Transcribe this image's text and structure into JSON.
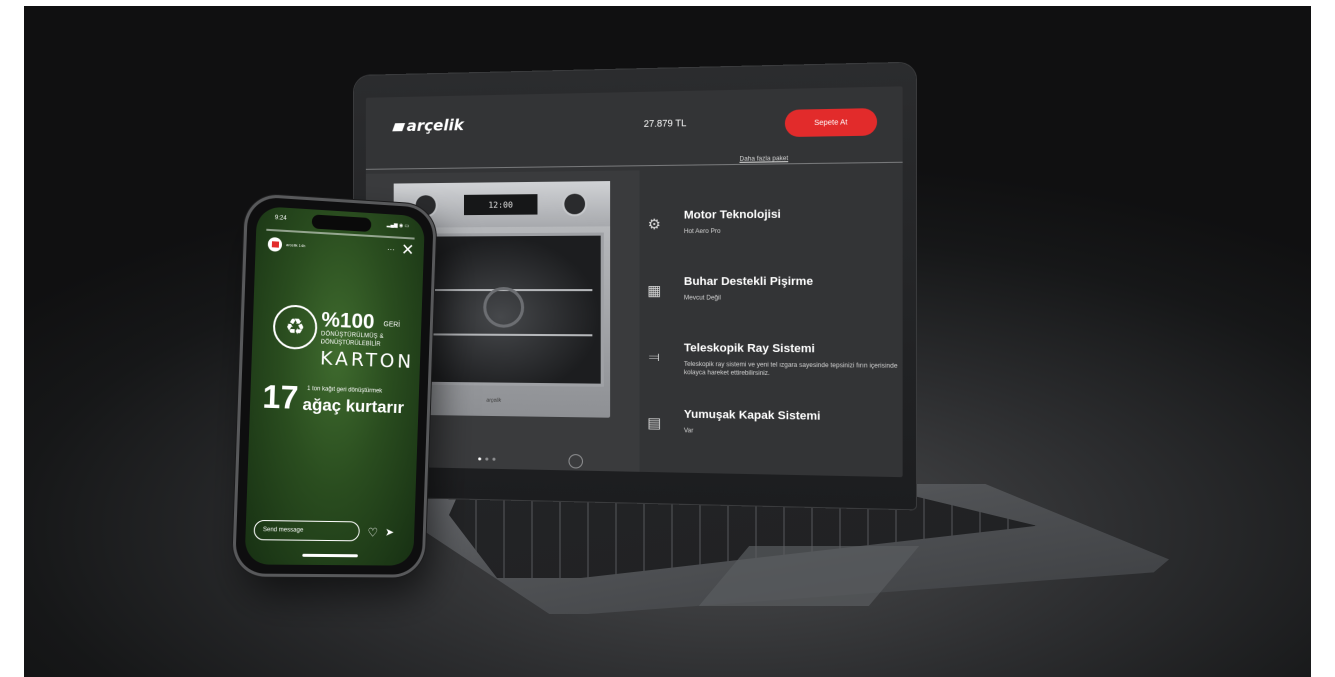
{
  "laptop": {
    "brand": "arçelik",
    "price": "27.879 TL",
    "cart_button": "Sepete At",
    "more_link": "Daha fazla paket",
    "oven_display": "12:00",
    "oven_logo": "arçelik",
    "features": [
      {
        "icon": "motor-icon",
        "title": "Motor Teknolojisi",
        "subtitle": "Hot Aero Pro"
      },
      {
        "icon": "steam-icon",
        "title": "Buhar Destekli Pişirme",
        "subtitle": "Mevcut Değil"
      },
      {
        "icon": "rail-icon",
        "title": "Teleskopik Ray Sistemi",
        "subtitle": "Teleskopik ray sistemi ve yeni tel ızgara sayesinde tepsinizi fırın içerisinde kolayca hareket ettirebilirsiniz."
      },
      {
        "icon": "door-icon",
        "title": "Yumuşak Kapak Sistemi",
        "subtitle": "Var"
      }
    ]
  },
  "phone": {
    "time": "9:24",
    "signal": "▂▄▆ ◉ ▭",
    "story_user": "arcelik 14h",
    "more": "···",
    "close": "✕",
    "pct": "%100",
    "geri": "GERİ",
    "line2": "DÖNÜŞTÜRÜLMÜŞ &",
    "line3": "DÖNÜŞTÜRÜLEBİLİR",
    "karton": "KARTON",
    "num": "17",
    "kagit": "1 ton kağıt geri dönüştürmek",
    "kurtarir": "ağaç kurtarır",
    "message_placeholder": "Send message",
    "heart": "♡",
    "send": "➤"
  }
}
